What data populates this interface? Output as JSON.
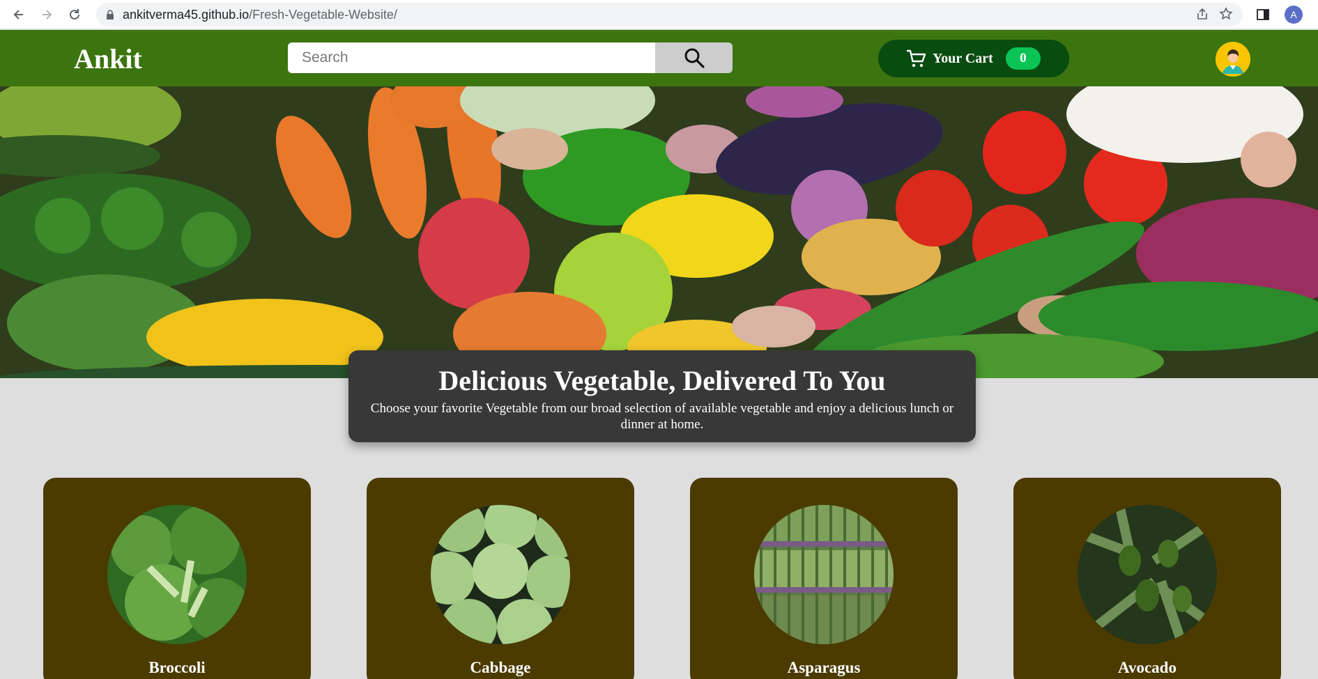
{
  "browser": {
    "url_host": "ankitverma45.github.io",
    "url_path": "/Fresh-Vegetable-Website/",
    "profile_initial": "A",
    "icons": [
      "back-arrow-icon",
      "forward-arrow-icon",
      "reload-icon",
      "lock-icon",
      "share-icon",
      "star-icon",
      "sidebar-icon"
    ]
  },
  "header": {
    "brand": "Ankit",
    "search_placeholder": "Search",
    "search_icon": "search-icon",
    "cart_label": "Your Cart",
    "cart_count": "0",
    "cart_icon": "cart-icon",
    "avatar_icon": "user-avatar-icon"
  },
  "hero": {
    "title": "Delicious Vegetable, Delivered To You",
    "description": "Choose your favorite Vegetable from our broad selection of available vegetable and enjoy a delicious lunch or dinner at home."
  },
  "products": [
    {
      "name": "Broccoli"
    },
    {
      "name": "Cabbage"
    },
    {
      "name": "Asparagus"
    },
    {
      "name": "Avocado"
    }
  ],
  "colors": {
    "header_green": "#3c7410",
    "cart_dark_green": "#084c10",
    "cart_badge": "#0ac556",
    "card_brown": "#4b3b00",
    "hero_card": "#383838",
    "page_bg": "#dedede"
  }
}
